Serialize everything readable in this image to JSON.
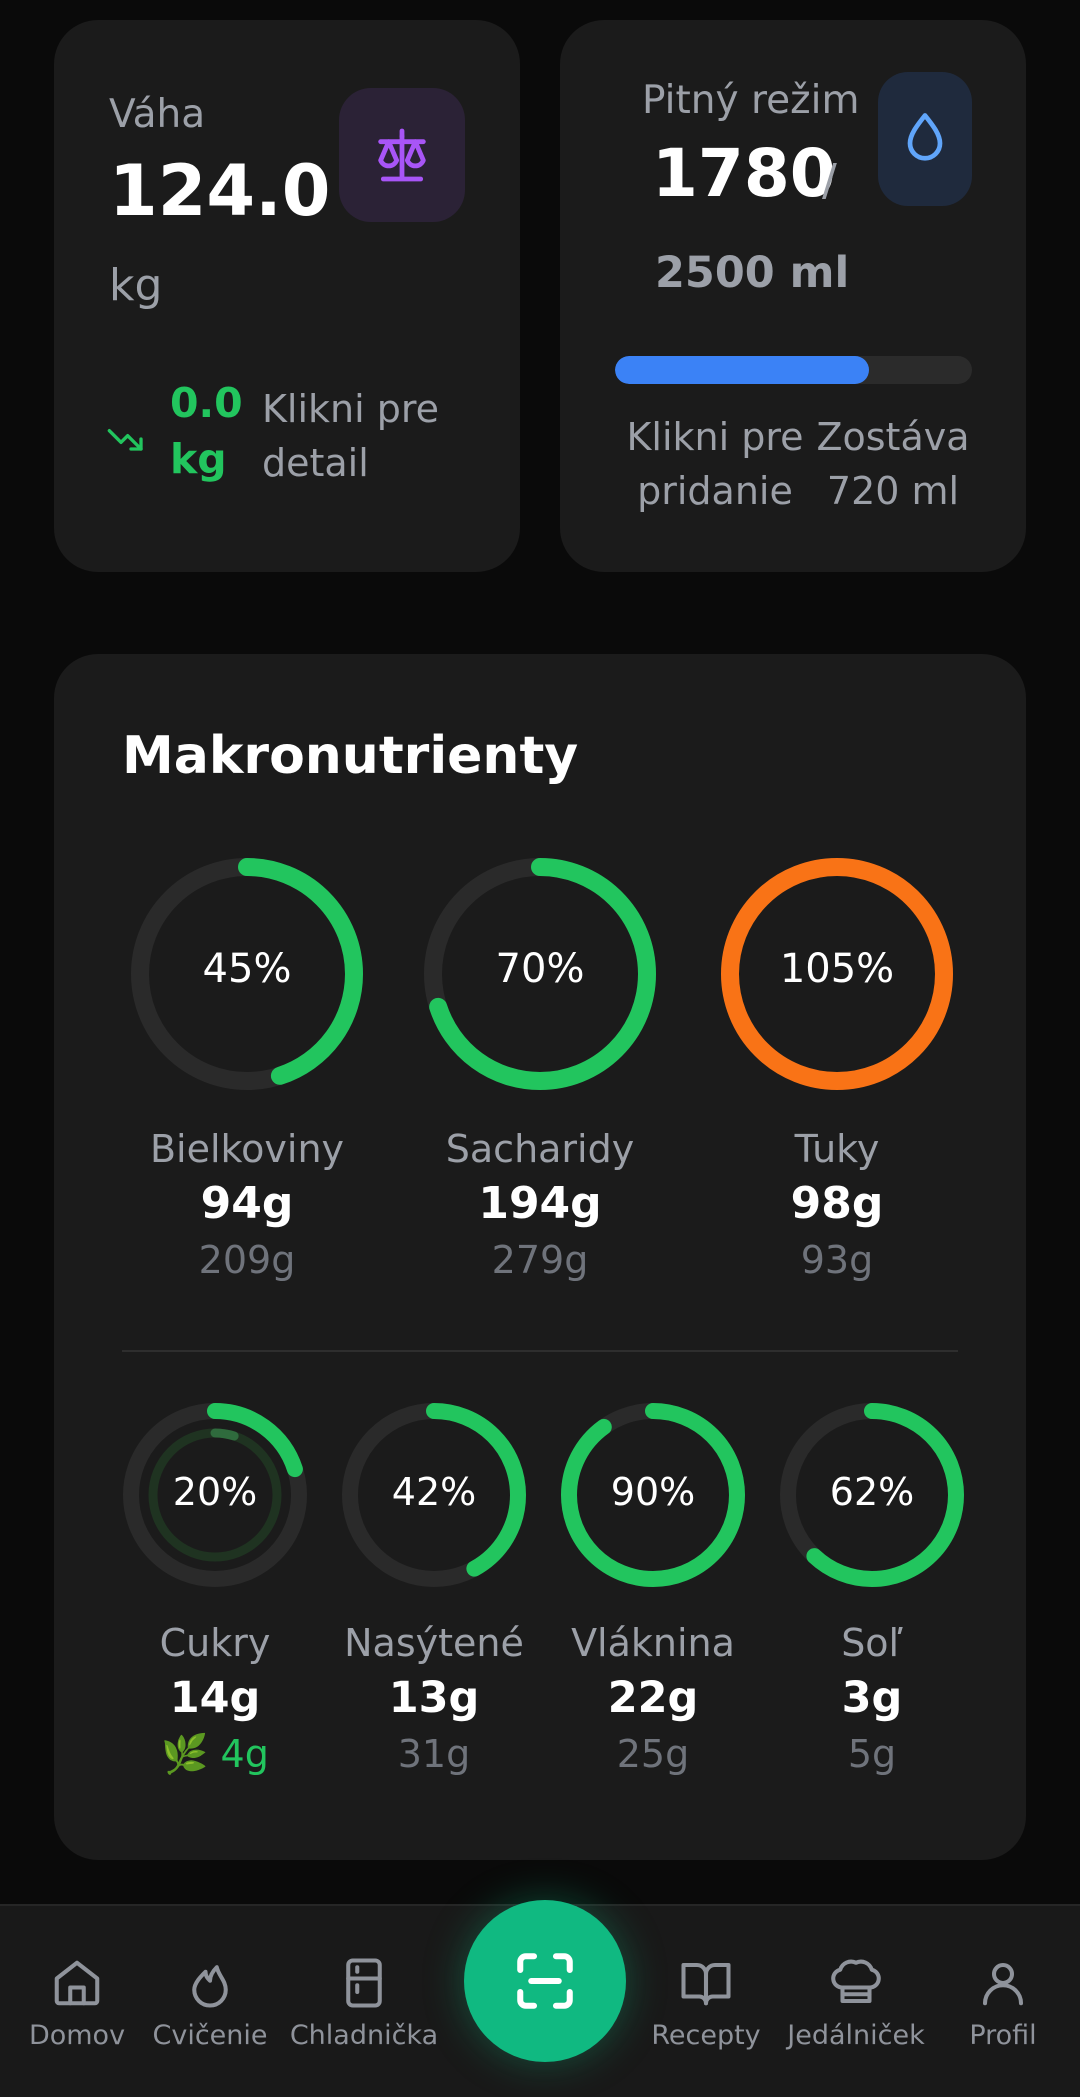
{
  "weight": {
    "label": "Váha",
    "value": "124.0",
    "unit": "kg",
    "delta": "0.0 kg",
    "hint": "Klikni pre detail",
    "icon": "scale-icon",
    "accent": "#a855f7"
  },
  "water": {
    "label": "Pitný režim",
    "value": "1780",
    "slash": "/",
    "goal": "2500 ml",
    "progress": 0.712,
    "hint": "Klikni pre pridanie",
    "remaining": "Zostáva 720 ml",
    "icon": "water-drop-icon",
    "accent": "#3b82f6"
  },
  "macros": {
    "title": "Makronutrienty",
    "primary": [
      {
        "name": "Bielkoviny",
        "value": "94g",
        "goal": "209g",
        "pct": "45%",
        "fraction": 0.45,
        "color": "#22c55e"
      },
      {
        "name": "Sacharidy",
        "value": "194g",
        "goal": "279g",
        "pct": "70%",
        "fraction": 0.7,
        "color": "#22c55e"
      },
      {
        "name": "Tuky",
        "value": "98g",
        "goal": "93g",
        "pct": "105%",
        "fraction": 1.0,
        "color": "#f97316"
      }
    ],
    "secondary": [
      {
        "name": "Cukry",
        "value": "14g",
        "goal": "🌿 4g",
        "pct": "20%",
        "fraction": 0.2,
        "inner_fraction": 0.05,
        "color": "#22c55e",
        "goal_green": true
      },
      {
        "name": "Nasýtené",
        "value": "13g",
        "goal": "31g",
        "pct": "42%",
        "fraction": 0.42,
        "color": "#22c55e"
      },
      {
        "name": "Vláknina",
        "value": "22g",
        "goal": "25g",
        "pct": "90%",
        "fraction": 0.9,
        "color": "#22c55e"
      },
      {
        "name": "Soľ",
        "value": "3g",
        "goal": "5g",
        "pct": "62%",
        "fraction": 0.62,
        "color": "#22c55e"
      }
    ]
  },
  "nav": {
    "items": [
      {
        "label": "Domov",
        "icon": "home-icon"
      },
      {
        "label": "Cvičenie",
        "icon": "flame-icon"
      },
      {
        "label": "Chladnička",
        "icon": "fridge-icon"
      },
      {
        "label": "Recepty",
        "icon": "book-icon"
      },
      {
        "label": "Jedálniček",
        "icon": "chef-hat-icon"
      },
      {
        "label": "Profil",
        "icon": "user-icon"
      }
    ],
    "scan_icon": "scan-icon",
    "scan_color": "#10b981"
  }
}
